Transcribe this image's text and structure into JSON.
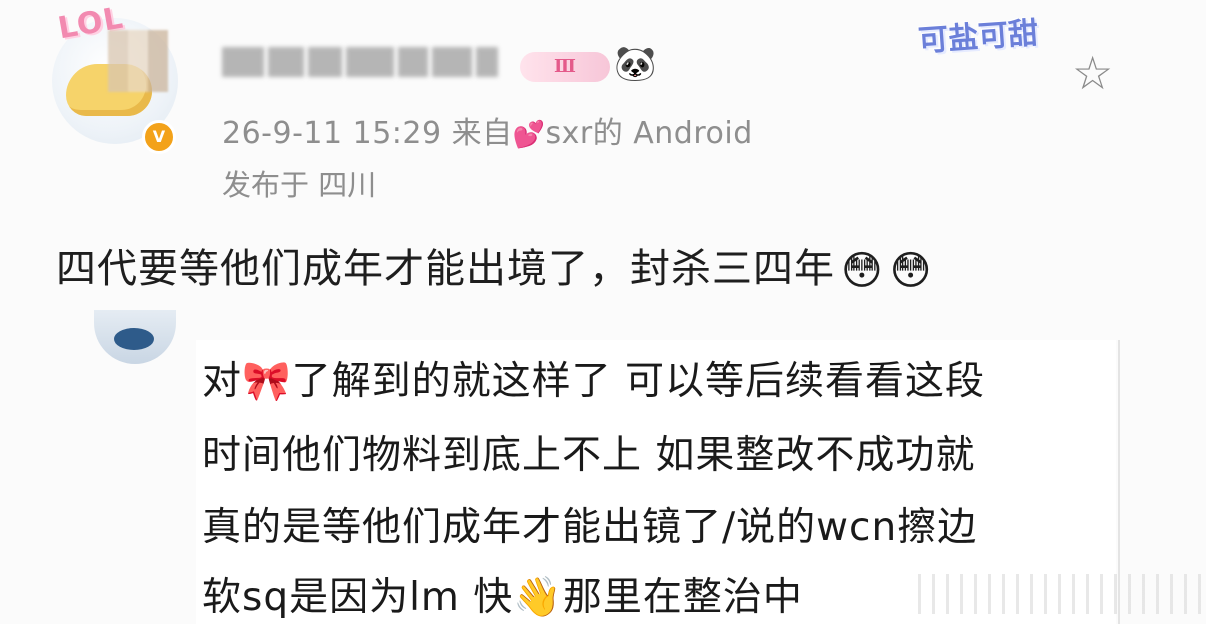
{
  "post": {
    "username": "██ ██ ██ ██",
    "level_badge": "Ⅲ",
    "vip_badge": "V",
    "timestamp": "26-9-11 15:29",
    "source_prefix": "来自",
    "source_heart": "💕",
    "source_device": "sxr的 Android",
    "location": "发布于 四川",
    "sticker_text": "可盐可甜",
    "content": "四代要等他们成年才能出境了，封杀三四年",
    "content_emoji": "😳"
  },
  "reply": {
    "line1_start": "对",
    "line1_emoji": "🎀",
    "line1_end": "了解到的就这样了 可以等后续看看这段",
    "line2": "时间他们物料到底上不上 如果整改不成功就",
    "line3": "真的是等他们成年才能出镜了/说的wcn擦边",
    "line4_start": "软sq是因为lm 快",
    "line4_emoji": "👋",
    "line4_end": "那里在整治中"
  },
  "icons": {
    "star": "star-icon",
    "panda": "panda-icon",
    "avatar": "avatar"
  },
  "colors": {
    "meta_gray": "#8e8e8e",
    "vip_orange": "#f3a21a",
    "level_pink": "#e45a8a"
  }
}
